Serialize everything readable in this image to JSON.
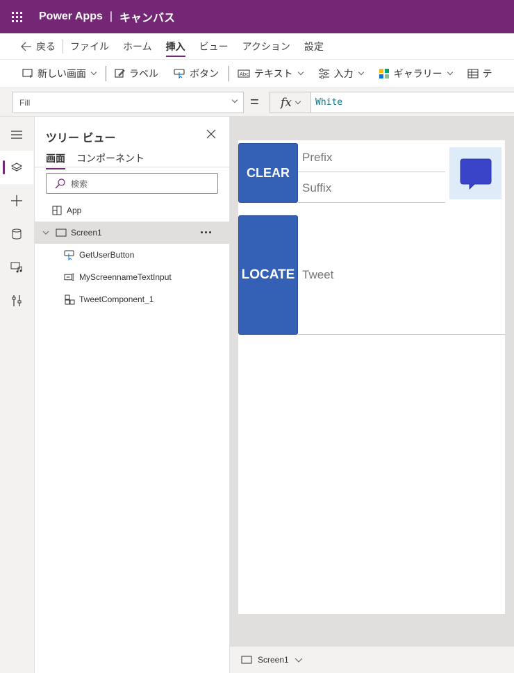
{
  "topbar": {
    "app_name": "Power Apps",
    "separator": "|",
    "studio_name": "キャンバス"
  },
  "menu": {
    "back": "戻る",
    "items": [
      "ファイル",
      "ホーム",
      "挿入",
      "ビュー",
      "アクション",
      "設定"
    ],
    "active": "挿入"
  },
  "commands": {
    "new_screen": "新しい画面",
    "label": "ラベル",
    "button": "ボタン",
    "text": "テキスト",
    "input": "入力",
    "gallery": "ギャラリー",
    "table_partial": "テ"
  },
  "formula": {
    "property": "Fill",
    "equals": "=",
    "fx": "fx",
    "value": "White"
  },
  "tree": {
    "title": "ツリー ビュー",
    "tabs": [
      "画面",
      "コンポーネント"
    ],
    "search_placeholder": "検索",
    "nodes": {
      "app": "App",
      "screen": "Screen1",
      "children": [
        "GetUserButton",
        "MyScreennameTextInput",
        "TweetComponent_1"
      ]
    }
  },
  "canvas": {
    "clear_label": "CLEAR",
    "prefix_placeholder": "Prefix",
    "suffix_placeholder": "Suffix",
    "locate_label": "LOCATE",
    "tweet_placeholder": "Tweet"
  },
  "statusbar": {
    "screen": "Screen1"
  },
  "colors": {
    "brand": "#742774",
    "button_blue": "#3460b5",
    "canvas_bg": "#e1dfdd"
  }
}
